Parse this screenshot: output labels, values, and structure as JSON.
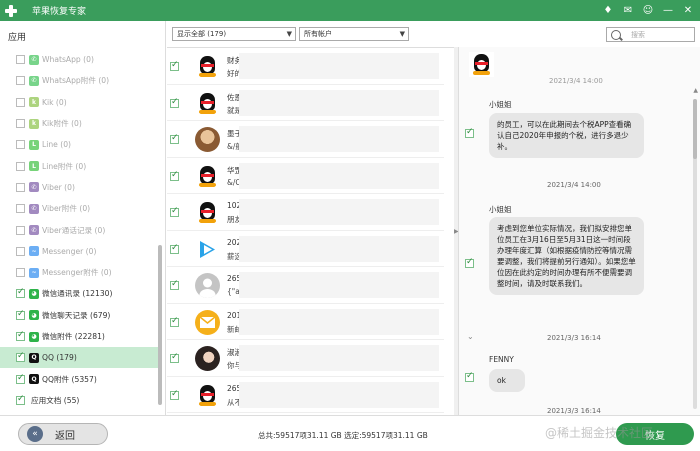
{
  "window": {
    "title": "苹果恢复专家"
  },
  "titlebar_icons": [
    "diamond-icon",
    "mail-icon",
    "chat-icon",
    "minimize-icon",
    "close-icon"
  ],
  "sidebar": {
    "header": "应用",
    "items": [
      {
        "label": "WhatsApp (0)",
        "icon": "whatsapp-icon",
        "checked": false,
        "dim": true
      },
      {
        "label": "WhatsApp附件 (0)",
        "icon": "whatsapp-icon",
        "checked": false,
        "dim": true
      },
      {
        "label": "Kik (0)",
        "icon": "kik-icon",
        "checked": false,
        "dim": true
      },
      {
        "label": "Kik附件 (0)",
        "icon": "kik-icon",
        "checked": false,
        "dim": true
      },
      {
        "label": "Line (0)",
        "icon": "line-icon",
        "checked": false,
        "dim": true
      },
      {
        "label": "Line附件 (0)",
        "icon": "line-icon",
        "checked": false,
        "dim": true
      },
      {
        "label": "Viber (0)",
        "icon": "viber-icon",
        "checked": false,
        "dim": true
      },
      {
        "label": "Viber附件 (0)",
        "icon": "viber-icon",
        "checked": false,
        "dim": true
      },
      {
        "label": "Viber通话记录 (0)",
        "icon": "viber-icon",
        "checked": false,
        "dim": true
      },
      {
        "label": "Messenger (0)",
        "icon": "messenger-icon",
        "checked": false,
        "dim": true
      },
      {
        "label": "Messenger附件 (0)",
        "icon": "messenger-icon",
        "checked": false,
        "dim": true
      },
      {
        "label": "微信通讯录 (12130)",
        "icon": "wechat-icon",
        "checked": true,
        "dim": false
      },
      {
        "label": "微信聊天记录 (679)",
        "icon": "wechat-icon",
        "checked": true,
        "dim": false
      },
      {
        "label": "微信附件 (22281)",
        "icon": "wechat-icon",
        "checked": true,
        "dim": false
      },
      {
        "label": "QQ (179)",
        "icon": "qq-icon",
        "checked": true,
        "dim": false,
        "selected": true
      },
      {
        "label": "QQ附件 (5357)",
        "icon": "qq-icon",
        "checked": true,
        "dim": false
      },
      {
        "label": "应用文档 (55)",
        "icon": "",
        "checked": true,
        "dim": false
      }
    ]
  },
  "filters": {
    "show_select": "显示全部 (179)",
    "account_select": "所有帐户",
    "search_placeholder": "搜索"
  },
  "conversations": [
    {
      "avatar": "qq-avatar",
      "line1": "财务",
      "line2": "好的"
    },
    {
      "avatar": "qq-avatar",
      "line1": "佐恩",
      "line2": "就是"
    },
    {
      "avatar": "photo-avatar",
      "line1": "墨子",
      "line2": "&/般"
    },
    {
      "avatar": "qq-avatar",
      "line1": "华罡",
      "line2": "&/OK"
    },
    {
      "avatar": "qq-avatar",
      "line1": "1027",
      "line2": "朋友"
    },
    {
      "avatar": "video-avatar",
      "line1": "2029",
      "line2": "薪选"
    },
    {
      "avatar": "default-avatar",
      "line1": "2658",
      "line2": "{\"app"
    },
    {
      "avatar": "mail-avatar",
      "line1": "2010",
      "line2": "新邮"
    },
    {
      "avatar": "girl-avatar",
      "line1": "淑淑",
      "line2": "你与"
    },
    {
      "avatar": "qq-avatar",
      "line1": "2659",
      "line2": "从不"
    }
  ],
  "chat": {
    "top_time": "2021/3/4 14:00",
    "messages": [
      {
        "sender": "小姐姐",
        "text": "的员工，可以在此期间去个税APP查看确认自己2020年申报的个税，进行多退少补。",
        "checked": true
      },
      {
        "time": "2021/3/4 14:00"
      },
      {
        "sender": "小姐姐",
        "text": "考虑到您单位实际情况，我们拟安排您单位员工在3月16日至5月31日这一时间段办理年度汇算（如根据疫情防控等情况需要调整，我们将提前另行通知）。如果您单位因在此约定的时间办理有所不便需要调整时间，请及时联系我们。",
        "checked": true
      },
      {
        "time": "2021/3/3 16:14"
      },
      {
        "sender": "FENNY",
        "text": "ok",
        "checked": true
      },
      {
        "time": "2021/3/3 16:14"
      }
    ]
  },
  "footer": {
    "back_label": "返回",
    "totals": "总共:59517项31.11 GB 选定:59517项31.11 GB",
    "recover_label": "恢复",
    "watermark": "@稀土掘金技术社区"
  }
}
